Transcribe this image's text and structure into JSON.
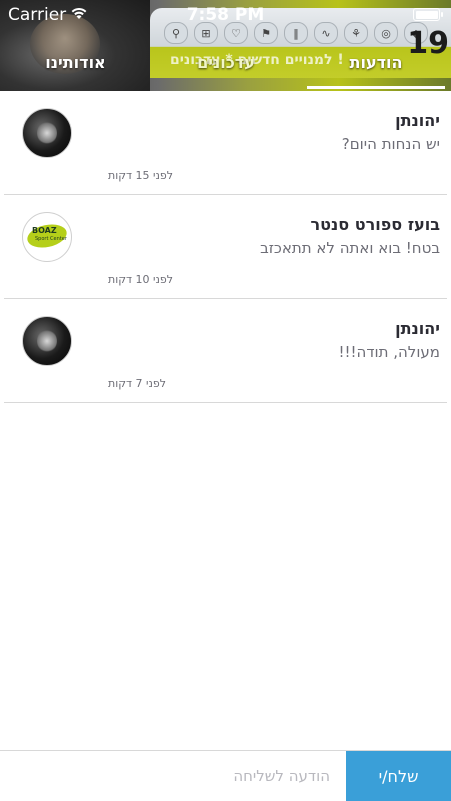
{
  "status_bar": {
    "carrier": "Carrier",
    "time": "7:58 PM",
    "wifi_icon": "wifi-icon",
    "battery_icon": "battery-icon"
  },
  "banner": {
    "number": "19",
    "ticker": "למנויים חדשים * עדכונים !",
    "icons": [
      "bike-icon",
      "dumbbell-icon",
      "heart-icon",
      "runner-icon",
      "cutlery-icon",
      "pulse-icon",
      "figure-icon",
      "ball-icon",
      "drop-icon"
    ]
  },
  "tabs": {
    "messages": "הודעות",
    "updates": "עדכונים",
    "about": "אודותינו"
  },
  "messages": [
    {
      "sender": "יהונתן",
      "text": "יש הנחות היום?",
      "time": "לפני 15 דקות",
      "avatar": "person"
    },
    {
      "sender": "בועז ספורט סנטר",
      "text": "בטח! בוא ואתה לא תתאכזב",
      "time": "לפני 10 דקות",
      "avatar": "logo"
    },
    {
      "sender": "יהונתן",
      "text": "מעולה, תודה!!!",
      "time": "לפני 7 דקות",
      "avatar": "person"
    }
  ],
  "logo": {
    "name": "BOAZ",
    "sub": "Sport Center"
  },
  "compose": {
    "placeholder": "הודעה לשליחה",
    "send_label": "שלח/י"
  },
  "colors": {
    "accent": "#3a9fd8",
    "separator": "#d8d8d8",
    "banner_green": "#b7c21a"
  }
}
